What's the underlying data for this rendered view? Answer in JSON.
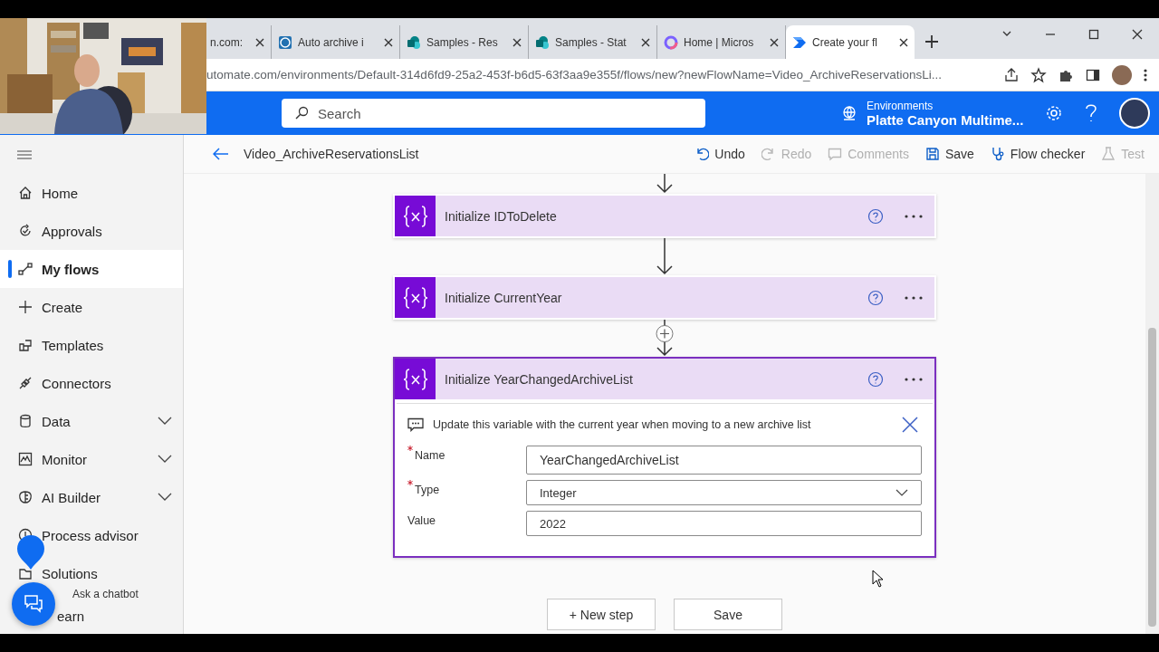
{
  "browser": {
    "tabs": [
      {
        "title": "n.com:",
        "selected": false
      },
      {
        "title": "Auto archive i",
        "selected": false
      },
      {
        "title": "Samples - Res",
        "selected": false
      },
      {
        "title": "Samples - Stat",
        "selected": false
      },
      {
        "title": "Home | Micros",
        "selected": false
      },
      {
        "title": "Create your fl",
        "selected": true
      }
    ],
    "address": "utomate.com/environments/Default-314d6fd9-25a2-453f-b6d5-63f3aa9e355f/flows/new?newFlowName=Video_ArchiveReservationsLi..."
  },
  "header": {
    "search_placeholder": "Search",
    "environment_label": "Environments",
    "environment": "Platte Canyon Multime..."
  },
  "sidebar": {
    "items": [
      {
        "label": "Home",
        "selected": false,
        "has_submenu": false
      },
      {
        "label": "Approvals",
        "selected": false,
        "has_submenu": false
      },
      {
        "label": "My flows",
        "selected": true,
        "has_submenu": false
      },
      {
        "label": "Create",
        "selected": false,
        "has_submenu": false
      },
      {
        "label": "Templates",
        "selected": false,
        "has_submenu": false
      },
      {
        "label": "Connectors",
        "selected": false,
        "has_submenu": false
      },
      {
        "label": "Data",
        "selected": false,
        "has_submenu": true
      },
      {
        "label": "Monitor",
        "selected": false,
        "has_submenu": true
      },
      {
        "label": "AI Builder",
        "selected": false,
        "has_submenu": true
      },
      {
        "label": "Process advisor",
        "selected": false,
        "has_submenu": false
      },
      {
        "label": "Solutions",
        "selected": false,
        "has_submenu": false
      },
      {
        "label": "earn",
        "selected": false,
        "has_submenu": false
      }
    ]
  },
  "flow": {
    "title": "Video_ArchiveReservationsList"
  },
  "toolbar": [
    {
      "label": "Undo",
      "disabled": false
    },
    {
      "label": "Redo",
      "disabled": true
    },
    {
      "label": "Comments",
      "disabled": true
    },
    {
      "label": "Save",
      "disabled": false
    },
    {
      "label": "Flow checker",
      "disabled": false
    },
    {
      "label": "Test",
      "disabled": true
    }
  ],
  "steps": [
    {
      "title": "Initialize IDToDelete",
      "selected": false,
      "expanded": false,
      "insert_above": false
    },
    {
      "title": "Initialize CurrentYear",
      "selected": false,
      "expanded": false,
      "insert_above": false
    },
    {
      "title": "Initialize YearChangedArchiveList",
      "selected": true,
      "expanded": true,
      "insert_above": true,
      "comment": "Update this variable with the current year when moving to a new archive list",
      "fields": [
        {
          "label": "Name",
          "required": true,
          "kind": "text",
          "value": "YearChangedArchiveList"
        },
        {
          "label": "Type",
          "required": true,
          "kind": "dropdown",
          "value": "Integer"
        },
        {
          "label": "Value",
          "required": false,
          "kind": "text",
          "value": "2022"
        }
      ]
    }
  ],
  "actions": [
    "+ New step",
    "Save"
  ],
  "chatbot": {
    "label": "Ask a chatbot"
  }
}
